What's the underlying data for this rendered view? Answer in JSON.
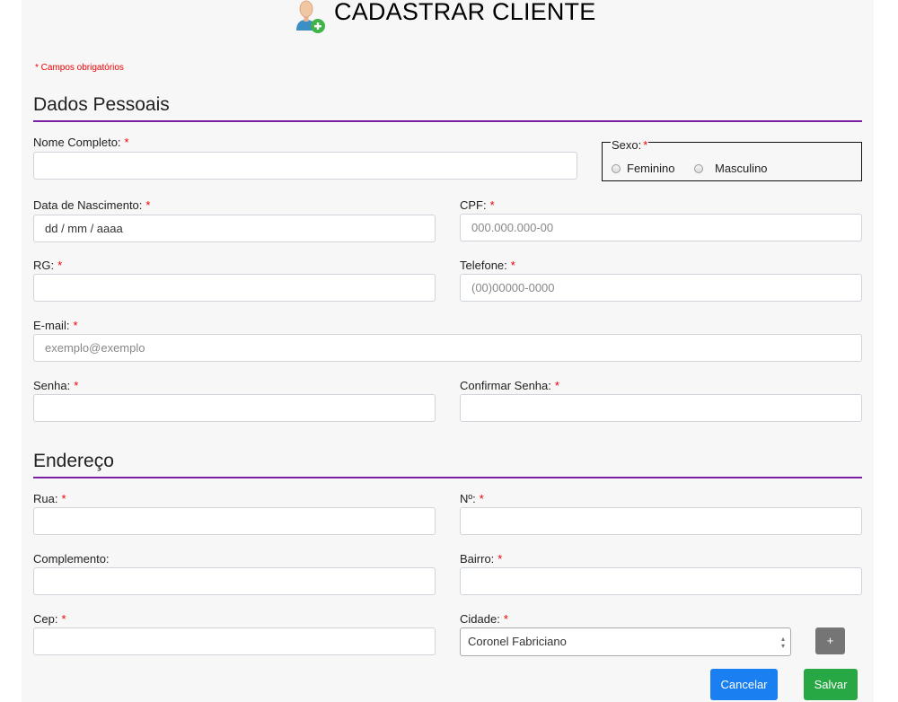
{
  "header": {
    "title": "CADASTRAR CLIENTE",
    "icon": "user-add-icon"
  },
  "required_note": "* Campos obrigatórios",
  "sections": {
    "personal": "Dados Pessoais",
    "address": "Endereço"
  },
  "fields": {
    "nome": {
      "label": "Nome Completo:",
      "placeholder": ""
    },
    "sexo": {
      "legend": "Sexo:",
      "options": [
        "Feminino",
        "Masculino"
      ]
    },
    "nascimento": {
      "label": "Data de Nascimento:",
      "value": "dd / mm / aaaa"
    },
    "cpf": {
      "label": "CPF:",
      "placeholder": "000.000.000-00"
    },
    "rg": {
      "label": "RG:",
      "placeholder": ""
    },
    "telefone": {
      "label": "Telefone:",
      "placeholder": "(00)00000-0000"
    },
    "email": {
      "label": "E-mail:",
      "placeholder": "exemplo@exemplo"
    },
    "senha": {
      "label": "Senha:",
      "placeholder": ""
    },
    "confirmar_senha": {
      "label": "Confirmar Senha:",
      "placeholder": ""
    },
    "rua": {
      "label": "Rua:",
      "placeholder": ""
    },
    "numero": {
      "label": "Nº:",
      "placeholder": ""
    },
    "complemento": {
      "label": "Complemento:",
      "placeholder": ""
    },
    "bairro": {
      "label": "Bairro:",
      "placeholder": ""
    },
    "cep": {
      "label": "Cep:",
      "placeholder": ""
    },
    "cidade": {
      "label": "Cidade:",
      "selected": "Coronel Fabriciano"
    }
  },
  "required_marker": "*",
  "buttons": {
    "add_city": "+",
    "cancel": "Cancelar",
    "save": "Salvar"
  },
  "colors": {
    "accent_rule": "#7b1fa2",
    "required": "#e00000",
    "cancel": "#1a7ff0",
    "save": "#28a745",
    "add": "#757575"
  }
}
